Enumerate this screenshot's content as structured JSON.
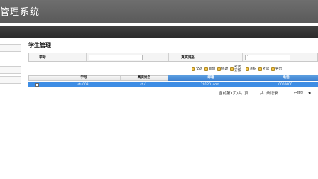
{
  "banner": {
    "title": "管理系统"
  },
  "sidebar": {
    "items": [
      "",
      "",
      ""
    ]
  },
  "page": {
    "title": "学生管理"
  },
  "search": {
    "id_label": "学号",
    "id_value": "",
    "name_label": "真实姓名",
    "name_value": "1"
  },
  "toolbar": {
    "buttons": [
      {
        "label": "全选"
      },
      {
        "label": "新增"
      },
      {
        "label": "修改"
      },
      {
        "label": "考试安排"
      },
      {
        "label": "违纪"
      },
      {
        "label": "考试"
      },
      {
        "label": "导出"
      }
    ]
  },
  "table": {
    "columns": [
      "",
      "学号",
      "真实姓名",
      "邮箱",
      "电话"
    ],
    "rows": [
      {
        "id": "stu003",
        "name": "stu1",
        "email": "20120 .com",
        "phone": "0000000"
      }
    ]
  },
  "pager": {
    "info": "当前第1页/共1页",
    "total": "共1条记录",
    "first": "首页",
    "prev": "上"
  },
  "colors": {
    "selected_row": "#3e8de4",
    "banner": "#5f5f5f",
    "navbar": "#2f2f2f"
  }
}
